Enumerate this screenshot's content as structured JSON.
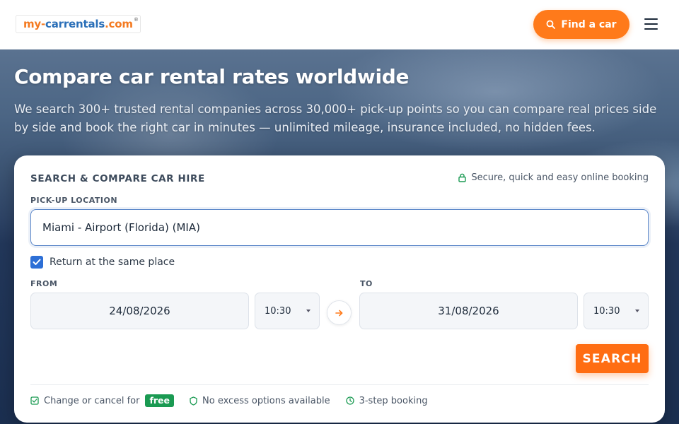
{
  "header": {
    "logo": {
      "part1": "my-",
      "part2": "carrentals",
      "part3": ".com",
      "reg": "®"
    },
    "find_car_label": "Find a car",
    "colors": {
      "accent": "#ff7a1a",
      "logo_orange": "#f47a20",
      "logo_blue": "#2a6fb8"
    }
  },
  "hero": {
    "title": "Compare car rental rates worldwide",
    "subtitle": "We search 300+ trusted rental companies across 30,000+ pick-up points so you can compare real prices side by side and book the right car in minutes — unlimited mileage, insurance included, no hidden fees."
  },
  "search_card": {
    "title": "SEARCH & COMPARE CAR HIRE",
    "secure_text": "Secure, quick and easy online booking",
    "pickup_label": "PICK-UP LOCATION",
    "pickup_value": "Miami - Airport (Florida) (MIA)",
    "return_same_label": "Return at the same place",
    "return_same_checked": true,
    "from_label": "FROM",
    "to_label": "TO",
    "from_date": "24/08/2026",
    "from_time": "10:30",
    "to_date": "31/08/2026",
    "to_time": "10:30",
    "search_label": "SEARCH",
    "perks": {
      "change_cancel": "Change or cancel for",
      "free_badge": "free",
      "no_excess": "No excess options available",
      "three_step": "3-step booking"
    },
    "icons": [
      "lock-icon",
      "checkbox-check-icon",
      "arrow-right-icon",
      "check-square-icon",
      "shield-icon",
      "clock-icon",
      "search-icon",
      "hamburger-menu-icon"
    ]
  }
}
